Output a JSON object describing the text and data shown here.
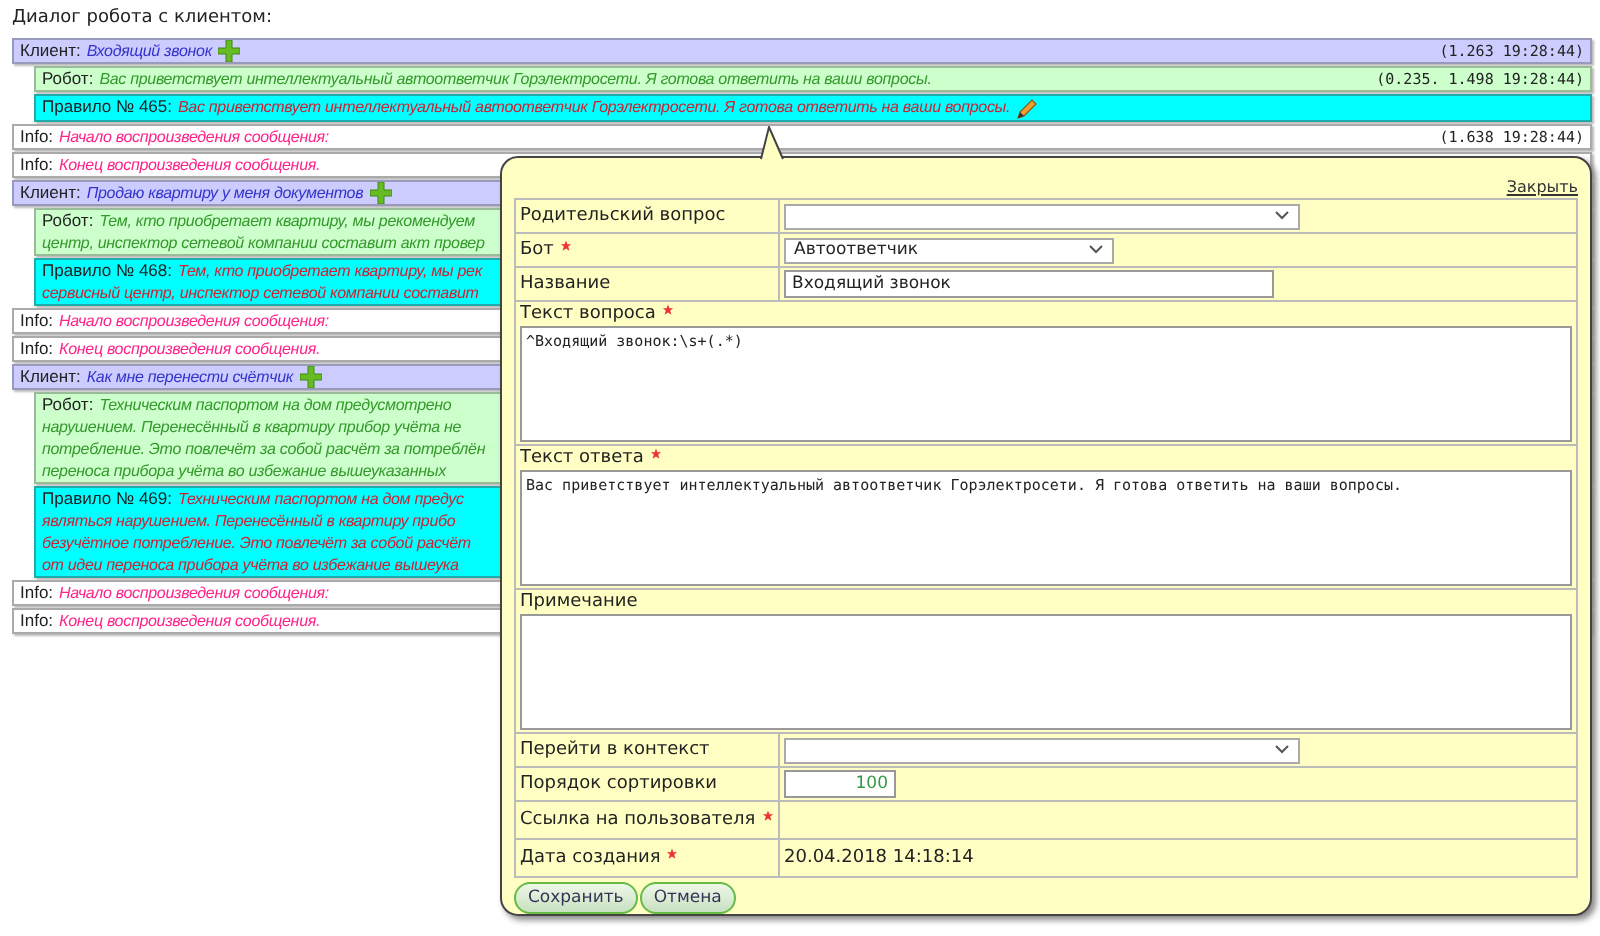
{
  "title": "Диалог робота с клиентом:",
  "messages": [
    {
      "kind": "client",
      "label": "Клиент:",
      "lines": [
        "Входящий звонок"
      ],
      "time": "(1.263 19:28:44)",
      "add_icon": true
    },
    {
      "kind": "robot",
      "label": "Робот:",
      "lines": [
        "Вас приветствует интеллектуальный автоответчик Горэлектросети. Я готова ответить на ваши вопросы."
      ],
      "time": "(0.235. 1.498 19:28:44)"
    },
    {
      "kind": "rule",
      "label": "Правило № 465:",
      "lines": [
        "Вас приветствует интеллектуальный автоответчик Горэлектросети. Я готова ответить на ваши вопросы."
      ],
      "edit_icon": true
    },
    {
      "kind": "info",
      "label": "Info:",
      "lines": [
        "Начало воспроизведения сообщения:"
      ],
      "time": "(1.638 19:28:44)"
    },
    {
      "kind": "info",
      "label": "Info:",
      "lines": [
        "Конец воспроизведения сообщения."
      ]
    },
    {
      "kind": "client",
      "label": "Клиент:",
      "lines": [
        "Продаю квартиру у меня документов"
      ],
      "add_icon": true
    },
    {
      "kind": "robot",
      "label": "Робот:",
      "lines": [
        "Тем, кто приобретает квартиру, мы рекомендуем",
        "центр, инспектор сетевой компании составит акт провер"
      ]
    },
    {
      "kind": "rule",
      "label": "Правило № 468:",
      "lines": [
        "Тем, кто приобретает квартиру, мы рек",
        "сервисный центр, инспектор сетевой компании составит"
      ]
    },
    {
      "kind": "info",
      "label": "Info:",
      "lines": [
        "Начало воспроизведения сообщения:"
      ]
    },
    {
      "kind": "info",
      "label": "Info:",
      "lines": [
        "Конец воспроизведения сообщения."
      ]
    },
    {
      "kind": "client",
      "label": "Клиент:",
      "lines": [
        "Как мне перенести счётчик"
      ],
      "add_icon": true
    },
    {
      "kind": "robot",
      "label": "Робот:",
      "lines": [
        "Техническим паспортом на дом предусмотрено",
        "нарушением. Перенесённый в квартиру прибор учёта не",
        "потребление. Это повлечёт за собой расчёт за потреблён",
        "переноса прибора учёта во избежание вышеуказанных"
      ]
    },
    {
      "kind": "rule",
      "label": "Правило № 469:",
      "lines": [
        "Техническим паспортом на дом предус",
        "являться нарушением. Перенесённый в квартиру прибо",
        "безучётное потребление. Это повлечёт за собой расчёт",
        "от идеи переноса прибора учёта во избежание вышеука"
      ]
    },
    {
      "kind": "info",
      "label": "Info:",
      "lines": [
        "Начало воспроизведения сообщения:"
      ]
    },
    {
      "kind": "info",
      "label": "Info:",
      "lines": [
        "Конец воспроизведения сообщения."
      ]
    }
  ],
  "popup": {
    "close": "Закрыть",
    "fields": [
      {
        "kind": "select",
        "label": "Родительский вопрос",
        "required": false
      },
      {
        "kind": "select",
        "label": "Бот",
        "required": true,
        "value": "Автоответчик"
      },
      {
        "kind": "input",
        "label": "Название",
        "required": false,
        "value": "Входящий звонок"
      },
      {
        "kind": "textarea",
        "label": "Текст вопроса",
        "required": true,
        "value": "^Входящий звонок:\\s+(.*)",
        "mono": true
      },
      {
        "kind": "textarea",
        "label": "Текст ответа",
        "required": true,
        "value": "Вас приветствует интеллектуальный автоответчик Горэлектросети. Я готова ответить на ваши вопросы.",
        "mono": true
      },
      {
        "kind": "textarea",
        "label": "Примечание",
        "required": false
      },
      {
        "kind": "select",
        "label": "Перейти в контекст",
        "required": false
      },
      {
        "kind": "number",
        "label": "Порядок сортировки",
        "required": false,
        "value": "100"
      },
      {
        "kind": "static",
        "label": "Ссылка на пользователя",
        "required": true
      },
      {
        "kind": "static",
        "label": "Дата создания",
        "required": true,
        "value": "20.04.2018 14:18:14"
      }
    ],
    "buttons": [
      "Сохранить",
      "Отмена"
    ]
  }
}
